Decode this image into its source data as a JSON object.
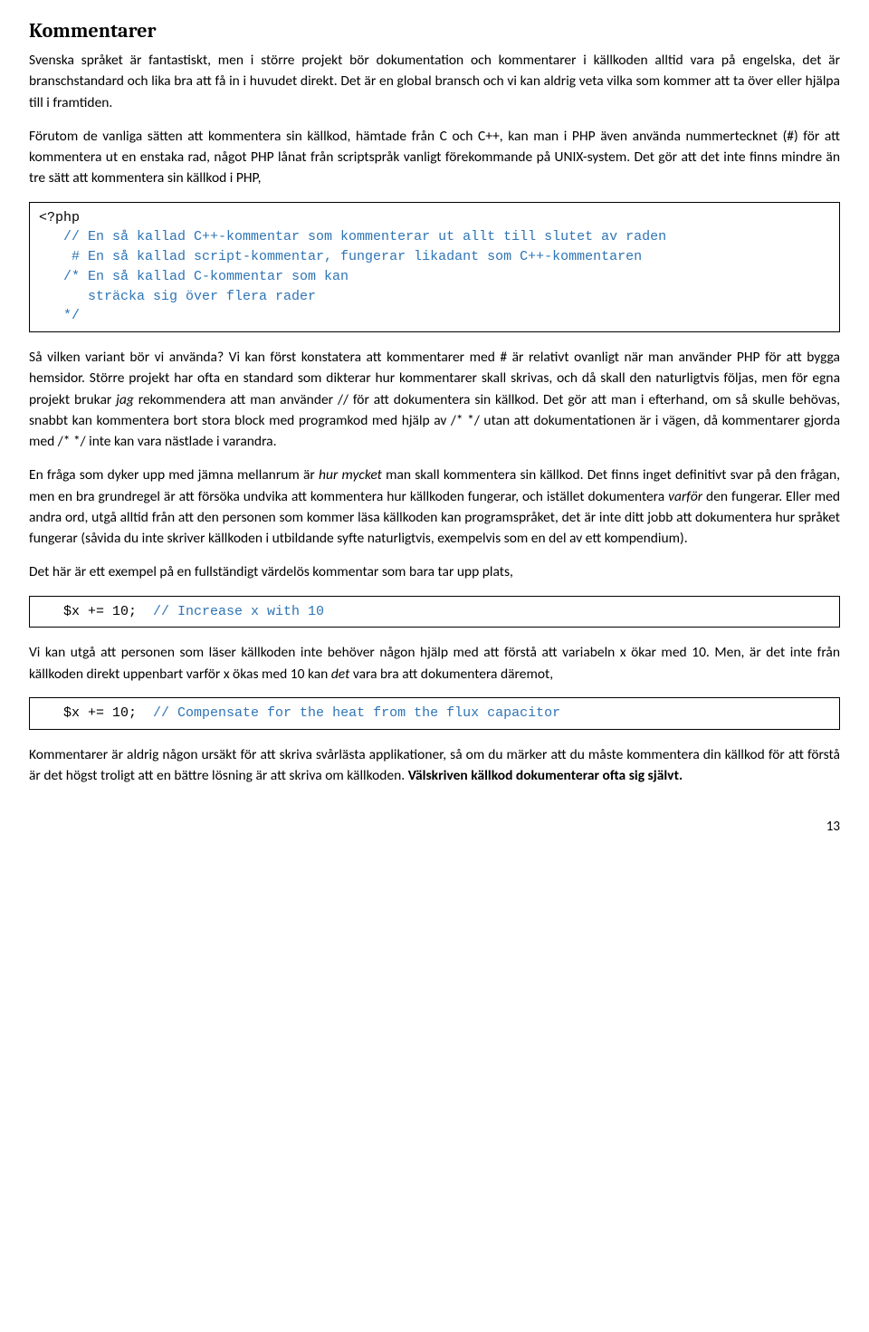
{
  "title": "Kommentarer",
  "para1": "Svenska språket är fantastiskt, men i större projekt bör dokumentation och kommentarer i källkoden alltid vara på engelska, det är branschstandard och lika bra att få in i huvudet direkt. Det är en global bransch och vi kan aldrig veta vilka som kommer att ta över eller hjälpa till i framtiden.",
  "para2": "Förutom de vanliga sätten att kommentera sin källkod, hämtade från C och C++, kan man i PHP även använda nummertecknet (#) för att kommentera ut en enstaka rad, något PHP lånat från scriptspråk vanligt förekommande på UNIX-system. Det gör att det inte finns mindre än tre sätt att kommentera sin  källkod i PHP,",
  "code1": {
    "l1": "<?php",
    "l2": "   // En så kallad C++-kommentar som kommenterar ut allt till slutet av raden",
    "l3": "    # En så kallad script-kommentar, fungerar likadant som C++-kommentaren",
    "l4": "   /* En så kallad C-kommentar som kan",
    "l5": "      sträcka sig över flera rader",
    "l6": "   */"
  },
  "para3a": "Så vilken variant bör vi använda? Vi kan först konstatera att kommentarer med # är relativt ovanligt när man använder PHP för att bygga hemsidor. Större projekt har ofta en standard som dikterar hur kommentarer skall skrivas, och då skall den naturligtvis följas, men för egna projekt brukar ",
  "para3_em": "jag",
  "para3b": " rekommendera att man använder // för att dokumentera sin källkod. Det gör att man i efterhand, om så skulle behövas, snabbt kan kommentera bort stora block med programkod med hjälp av /* */ utan att dokumentationen är i vägen, då kommentarer gjorda med /* */ inte kan vara nästlade i varandra.",
  "para4a": "En fråga som dyker upp med jämna mellanrum är ",
  "para4_em1": "hur mycket",
  "para4b": " man skall kommentera sin källkod. Det finns inget definitivt svar på den frågan, men en bra grundregel är att försöka undvika att kommentera hur källkoden fungerar, och istället dokumentera ",
  "para4_em2": "varför",
  "para4c": " den fungerar. Eller med andra ord, utgå alltid från att den personen som kommer läsa källkoden kan programspråket, det är inte ditt jobb att dokumentera hur språket fungerar (såvida du inte skriver källkoden i utbildande syfte naturligtvis, exempelvis som en del av ett kompendium).",
  "para5": "Det här är ett exempel på en fullständigt värdelös kommentar som bara tar upp plats,",
  "code2": {
    "black": "   $x += 10;  ",
    "comment": "// Increase x with 10"
  },
  "para6a": "Vi kan utgå att personen som läser källkoden inte behöver någon hjälp med att förstå att variabeln x ökar med 10. Men, är det inte från källkoden direkt uppenbart varför x ökas med 10 kan ",
  "para6_em": "det",
  "para6b": " vara bra att dokumentera däremot,",
  "code3": {
    "black": "   $x += 10;  ",
    "comment": "// Compensate for the heat from the flux capacitor"
  },
  "para7a": "Kommentarer är aldrig någon ursäkt för att skriva svårlästa applikationer, så om du märker att du måste kommentera din källkod för att förstå är det högst troligt att en bättre lösning är att skriva om källkoden. ",
  "para7_strong": "Välskriven källkod dokumenterar ofta sig självt.",
  "pagenum": "13"
}
